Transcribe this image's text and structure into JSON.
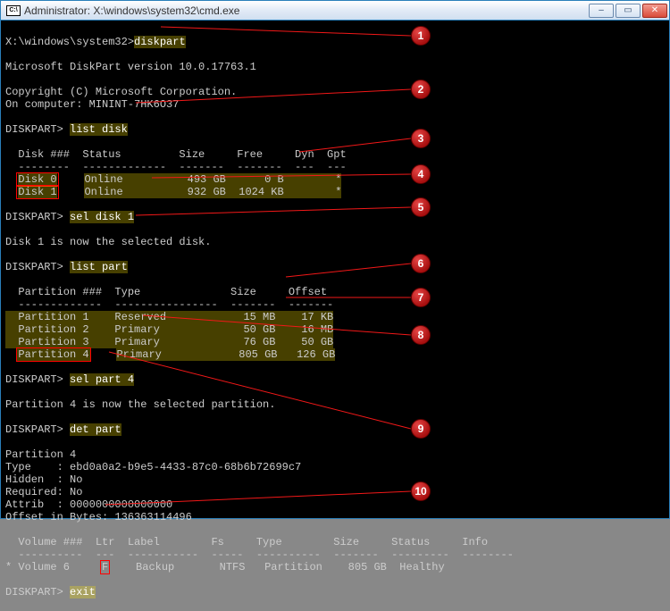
{
  "window": {
    "title": "Administrator: X:\\windows\\system32\\cmd.exe",
    "icon_label": "C:\\"
  },
  "prompt_path": "X:\\windows\\system32>",
  "dp_prompt": "DISKPART>",
  "commands": {
    "diskpart": "diskpart",
    "list_disk": "list disk",
    "sel_disk": "sel disk 1",
    "list_part": "list part",
    "sel_part": "sel part 4",
    "det_part": "det part",
    "exit": "exit"
  },
  "output": {
    "version": "Microsoft DiskPart version 10.0.17763.1",
    "copyright": "Copyright (C) Microsoft Corporation.",
    "computer": "On computer: MININT-7HK6O37",
    "disk_header": "  Disk ###  Status         Size     Free     Dyn  Gpt",
    "disk_divider": "  --------  -------------  -------  -------  ---  ---",
    "disk0_label": "Disk 0",
    "disk0_row": "Online          493 GB      0 B        *",
    "disk1_label": "Disk 1",
    "disk1_row": "Online          932 GB  1024 KB        *",
    "disk_selected": "Disk 1 is now the selected disk.",
    "part_header": "  Partition ###  Type              Size     Offset",
    "part_divider": "  -------------  ----------------  -------  -------",
    "part1": "  Partition 1    Reserved            15 MB    17 KB",
    "part2": "  Partition 2    Primary             50 GB    16 MB",
    "part3": "  Partition 3    Primary             76 GB    50 GB",
    "part4_label": "Partition 4",
    "part4_row": "Primary            805 GB   126 GB",
    "part_selected": "Partition 4 is now the selected partition.",
    "det_title": "Partition 4",
    "det_type": "Type    : ebd0a0a2-b9e5-4433-87c0-68b6b72699c7",
    "det_hidden": "Hidden  : No",
    "det_required": "Required: No",
    "det_attrib": "Attrib  : 0000000000000000",
    "det_offset": "Offset in Bytes: 136363114496",
    "vol_header": "  Volume ###  Ltr  Label        Fs     Type        Size     Status     Info",
    "vol_divider": "  ----------  ---  -----------  -----  ----------  -------  ---------  --------",
    "vol_prefix": "* Volume 6    ",
    "vol_ltr": "F",
    "vol_rest": "   Backup       NTFS   Partition    805 GB  Healthy"
  },
  "callouts": [
    "1",
    "2",
    "3",
    "4",
    "5",
    "6",
    "7",
    "8",
    "9",
    "10"
  ]
}
